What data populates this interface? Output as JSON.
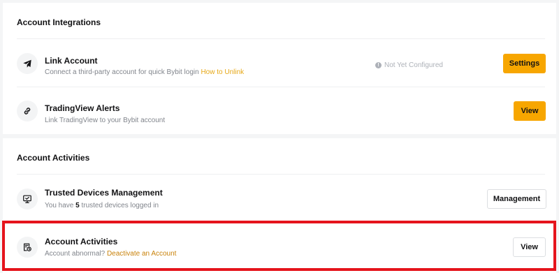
{
  "integrations": {
    "title": "Account Integrations",
    "link_account": {
      "title": "Link Account",
      "desc": "Connect a third-party account for quick Bybit login",
      "link": "How to Unlink",
      "status": "Not Yet Configured",
      "status_icon": "!",
      "button": "Settings"
    },
    "tradingview": {
      "title": "TradingView Alerts",
      "desc": "Link TradingView to your Bybit account",
      "button": "View"
    }
  },
  "activities": {
    "title": "Account Activities",
    "trusted_devices": {
      "title": "Trusted Devices Management",
      "desc_prefix": "You have",
      "count": "5",
      "desc_suffix": "trusted devices logged in",
      "button": "Management"
    },
    "account_activities": {
      "title": "Account Activities",
      "desc": "Account abnormal?",
      "link": "Deactivate an Account",
      "button": "View"
    }
  },
  "colors": {
    "accent": "#f7a600",
    "link": "#e6a817",
    "highlight": "#e5141c",
    "background": "#f4f5f6"
  },
  "icons": {
    "link_account": "paper-plane-icon",
    "tradingview": "chain-link-icon",
    "trusted_devices": "monitor-check-icon",
    "account_activities": "document-clock-icon",
    "status": "info-icon"
  }
}
